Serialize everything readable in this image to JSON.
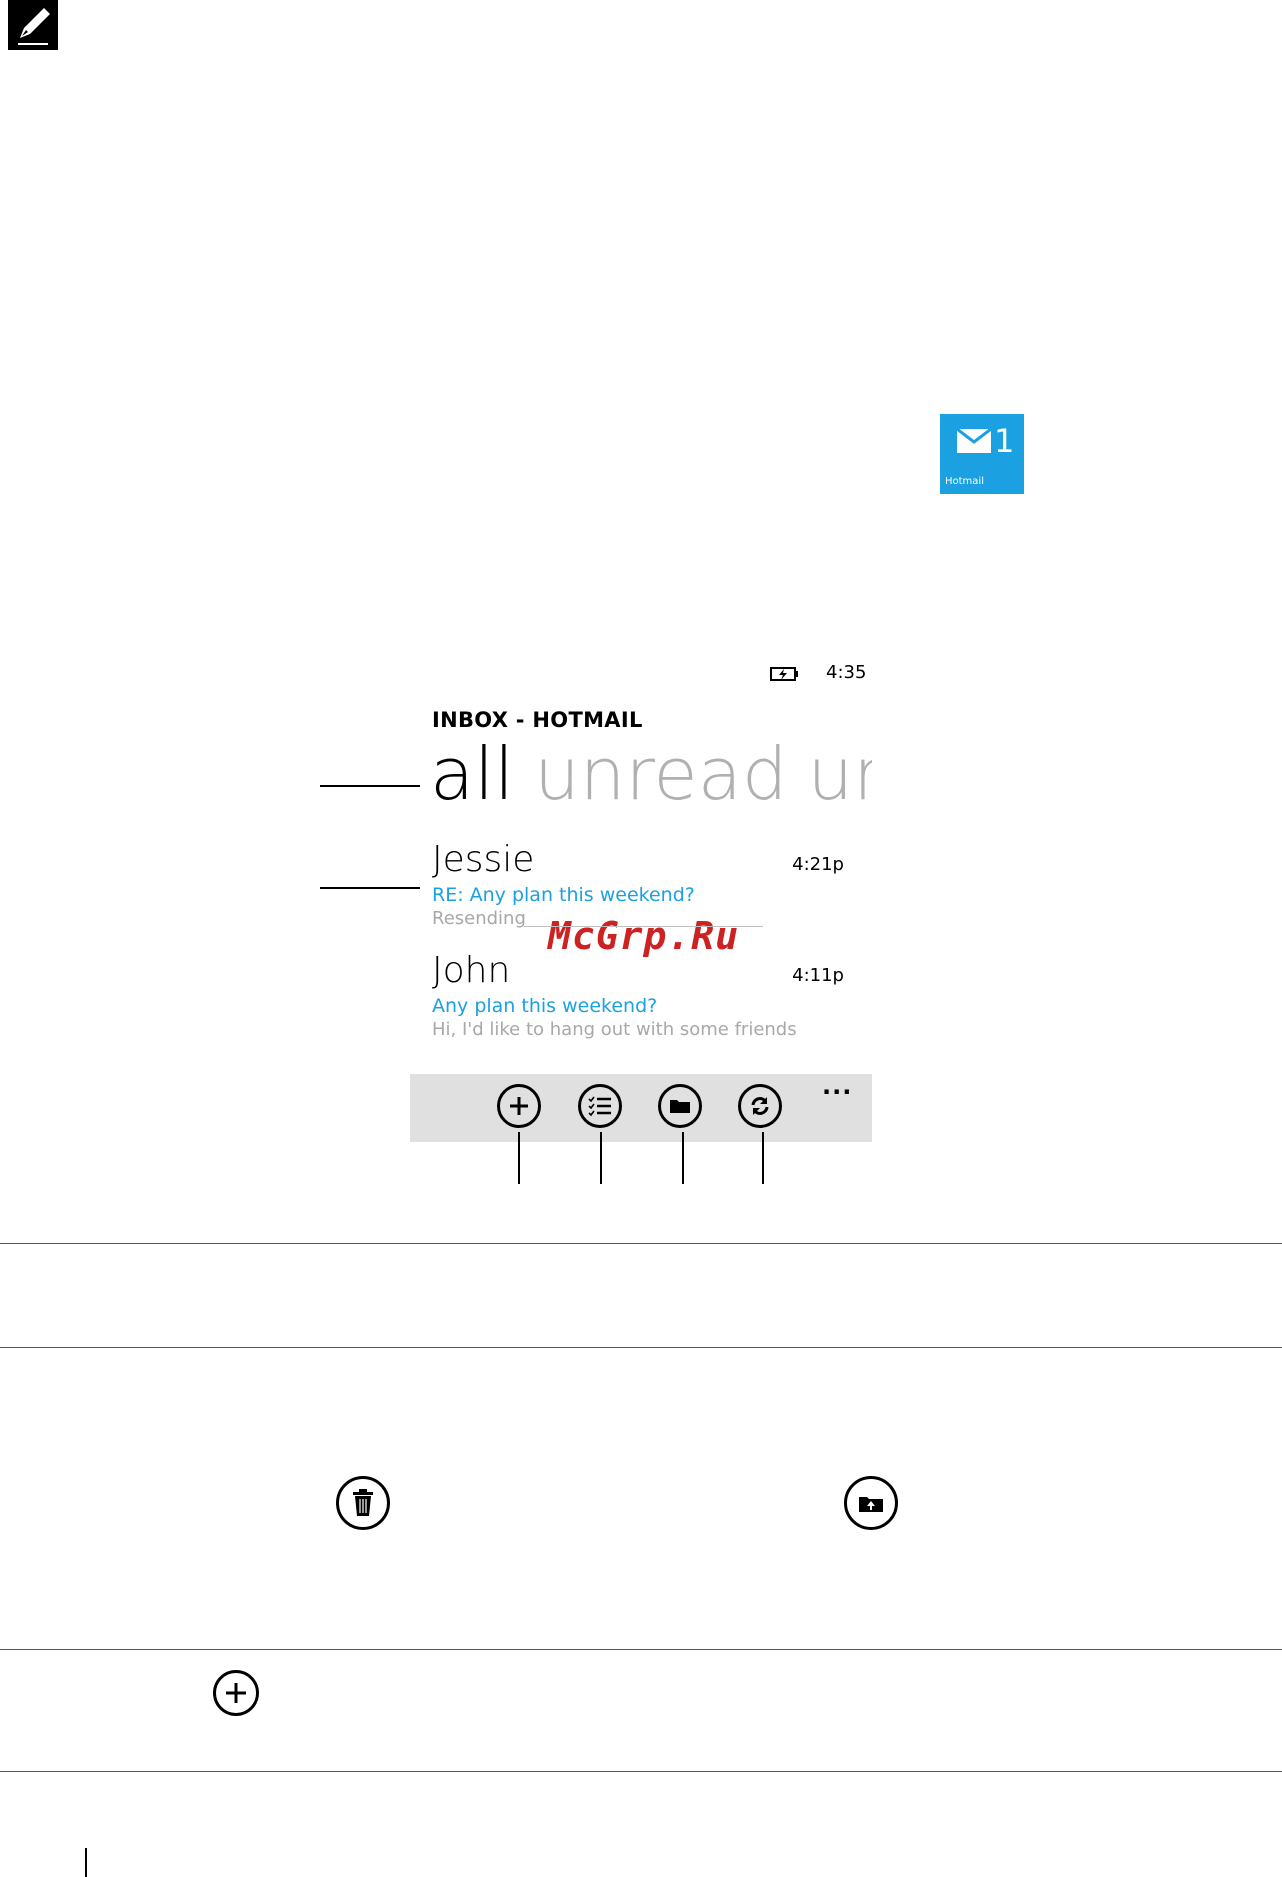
{
  "tile": {
    "count": "1",
    "label": "Hotmail",
    "color": "#1ba1e2"
  },
  "phone": {
    "status": {
      "time": "4:35",
      "battery_icon": "battery-charging-icon"
    },
    "inbox_title": "INBOX - HOTMAIL",
    "pivots": [
      "all",
      "unread",
      "urge"
    ],
    "messages": [
      {
        "sender": "Jessie",
        "subject": "RE: Any plan this weekend?",
        "preview": "Resending",
        "time": "4:21p"
      },
      {
        "sender": "John",
        "subject": "Any plan this weekend?",
        "preview": "Hi, I'd like to hang out with some friends",
        "time": "4:11p"
      }
    ],
    "appbar": {
      "buttons": [
        "new-icon",
        "select-icon",
        "folder-icon",
        "sync-icon"
      ],
      "more": "..."
    }
  },
  "watermark": "McGrp.Ru",
  "table_icons": [
    "trash-icon",
    "move-icon",
    "add-icon"
  ],
  "accent_color": "#1ba1e2"
}
